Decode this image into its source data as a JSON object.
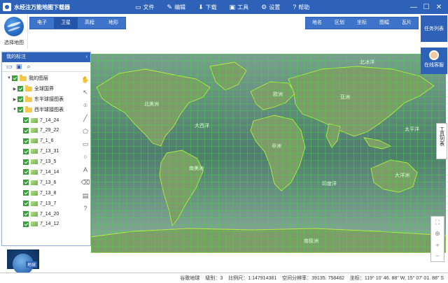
{
  "window": {
    "title": "水经注万能地图下载器"
  },
  "menu": [
    {
      "label": "文件",
      "icon": "folder-icon"
    },
    {
      "label": "编辑",
      "icon": "edit-icon"
    },
    {
      "label": "下载",
      "icon": "download-icon"
    },
    {
      "label": "工具",
      "icon": "toolbox-icon"
    },
    {
      "label": "设置",
      "icon": "gear-icon"
    },
    {
      "label": "帮助",
      "icon": "help-icon"
    }
  ],
  "left_strip": {
    "select_map_label": "选择地图"
  },
  "map_types": [
    "电子",
    "卫星",
    "高程",
    "地形"
  ],
  "map_tools": [
    "地名",
    "区划",
    "坐标",
    "图幅",
    "瓦片"
  ],
  "right_panel": {
    "task_list": "任务列表",
    "online_service": "在线客服",
    "tool_list": "工具列表"
  },
  "layer_panel": {
    "title": "我的标注",
    "tree": [
      {
        "level": 0,
        "label": "我的图层",
        "type": "folder",
        "expanded": true
      },
      {
        "level": 1,
        "label": "全球国界",
        "type": "folder",
        "expanded": false
      },
      {
        "level": 1,
        "label": "东半球接图表",
        "type": "folder",
        "expanded": false
      },
      {
        "level": 1,
        "label": "西半球接图表",
        "type": "folder",
        "expanded": true
      },
      {
        "level": 2,
        "label": "7_14_24",
        "type": "leaf"
      },
      {
        "level": 2,
        "label": "7_29_22",
        "type": "leaf"
      },
      {
        "level": 2,
        "label": "7_1_6",
        "type": "leaf"
      },
      {
        "level": 2,
        "label": "7_13_31",
        "type": "leaf"
      },
      {
        "level": 2,
        "label": "7_13_5",
        "type": "leaf"
      },
      {
        "level": 2,
        "label": "7_14_14",
        "type": "leaf"
      },
      {
        "level": 2,
        "label": "7_13_6",
        "type": "leaf"
      },
      {
        "level": 2,
        "label": "7_13_8",
        "type": "leaf"
      },
      {
        "level": 2,
        "label": "7_13_7",
        "type": "leaf"
      },
      {
        "level": 2,
        "label": "7_14_20",
        "type": "leaf"
      },
      {
        "level": 2,
        "label": "7_14_12",
        "type": "leaf"
      }
    ]
  },
  "map_labels": [
    "北冰洋",
    "北美洲",
    "欧洲",
    "亚洲",
    "大西洋",
    "太平洋",
    "非洲",
    "南美洲",
    "印度洋",
    "大洋洲",
    "南极洲"
  ],
  "minimap": {
    "label": "地球"
  },
  "status": {
    "source": "谷歌地球",
    "level": "级别：3",
    "scale": "比例尺：1:147914381",
    "resolution": "空间分辨率：39135. 758482",
    "coordinate": "坐标：119° 10' 46. 88\" W, 15° 07' 01. 88\" S"
  },
  "colors": {
    "accent": "#2d62b8",
    "grid": "#35e635",
    "land_outline": "#b6f040"
  }
}
